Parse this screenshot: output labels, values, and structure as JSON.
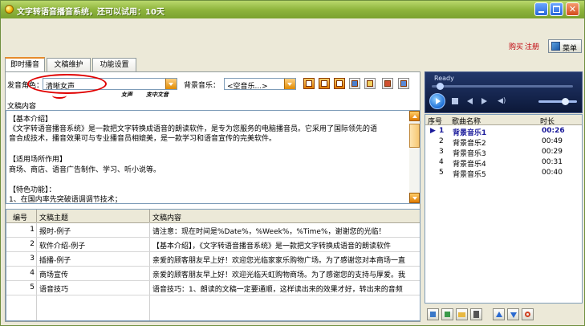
{
  "window": {
    "title": "文字转语音播音系统，还可以试用：10天",
    "controls": [
      "minimize",
      "maximize",
      "close"
    ]
  },
  "header": {
    "buy_label": "购买",
    "register_label": "注册",
    "menu_label": "菜单",
    "menu_icon": "menu-icon"
  },
  "tabs": [
    {
      "label": "即时播音",
      "active": true
    },
    {
      "label": "文稿维护",
      "active": false
    },
    {
      "label": "功能设置",
      "active": false
    }
  ],
  "voice": {
    "label": "发音角色：",
    "value": "清晰女声",
    "annotation_1": "女声",
    "annotation_2": "支中文音",
    "highlight_color": "#e00000"
  },
  "bgm": {
    "label": "背景音乐：",
    "value": "<空音乐...>"
  },
  "toolbar_icons": [
    "play-icon",
    "pause-icon",
    "stop-icon",
    "music-icon",
    "script-icon",
    "export-icon",
    "screen-icon"
  ],
  "content": {
    "label": "文稿内容",
    "lines": [
      "【基本介绍】",
      "《文字转语音播音系统》是一款把文字转换成语音的朗读软件，是专为您服务的电脑播音员。它采用了国际领先的语",
      "音合成技术，播音效果可与专业播音员相媲美，是一款学习和语音宣传的完美软件。",
      "",
      "【适用场所作用】",
      "  商场、商店、语音广告制作、学习、听小说等。",
      "",
      "【特色功能】：",
      "  1、在国内率先突破语调调节技术；"
    ]
  },
  "table": {
    "headers": [
      "编号",
      "文稿主题",
      "文稿内容"
    ],
    "rows": [
      {
        "id": "1",
        "theme": "报时-例子",
        "content": "请注意：现在时间是%Date%，%Week%，%Time%，谢谢您的光临！"
      },
      {
        "id": "2",
        "theme": "软件介绍-例子",
        "content": "【基本介绍】，《文字转语音播音系统》是一款把文字转换成语音的朗读软件"
      },
      {
        "id": "3",
        "theme": "插播-例子",
        "content": "亲爱的顾客朋友早上好！欢迎您光临家家乐购物广场。为了感谢您对本商场一直"
      },
      {
        "id": "4",
        "theme": "商场宣传",
        "content": "亲爱的顾客朋友早上好！欢迎光临天虹购物商场。为了感谢您的支持与厚爱。我"
      },
      {
        "id": "5",
        "theme": "语音技巧",
        "content": "语音技巧：1、朗读的文稿一定要通顺，这样读出来的效果才好，转出来的音频"
      }
    ]
  },
  "player": {
    "status": "Ready",
    "accent": "#1f6fd6",
    "bg": "#0c1838"
  },
  "playlist": {
    "headers": [
      "序号",
      "歌曲名称",
      "时长"
    ],
    "rows": [
      {
        "no": "1",
        "name": "背景音乐1",
        "duration": "00:26",
        "current": true
      },
      {
        "no": "2",
        "name": "背景音乐2",
        "duration": "00:49",
        "current": false
      },
      {
        "no": "3",
        "name": "背景音乐3",
        "duration": "00:29",
        "current": false
      },
      {
        "no": "4",
        "name": "背景音乐4",
        "duration": "00:31",
        "current": false
      },
      {
        "no": "5",
        "name": "背景音乐5",
        "duration": "00:40",
        "current": false
      }
    ]
  },
  "playlist_toolbar": [
    "add-music-icon",
    "edit-music-icon",
    "folder-icon",
    "delete-icon",
    "move-up-icon",
    "move-down-icon",
    "loop-icon"
  ]
}
